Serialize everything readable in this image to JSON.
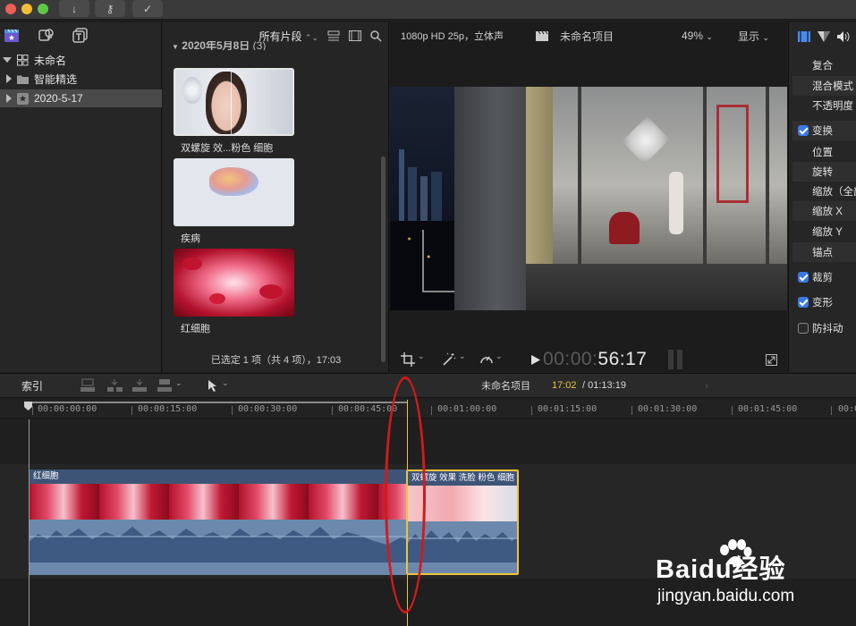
{
  "titlebar": {
    "buttons": [
      {
        "icon": "download-icon",
        "glyph": "↓"
      },
      {
        "icon": "key-icon",
        "glyph": "⚷"
      },
      {
        "icon": "checkmark-icon",
        "glyph": "✓"
      }
    ]
  },
  "sidebar": {
    "items": [
      {
        "label": "未命名",
        "icon": "library-icon"
      },
      {
        "label": "智能精选",
        "icon": "folder-icon"
      },
      {
        "label": "2020-5-17",
        "icon": "event-star-icon"
      }
    ]
  },
  "browser": {
    "filter_label": "所有片段",
    "section_date": "2020年5月8日",
    "section_count": "(3)",
    "clips": [
      {
        "label": "双螺旋 效...粉色 细胞"
      },
      {
        "label": "疾病"
      },
      {
        "label": "红细胞"
      }
    ],
    "status": "已选定 1 项（共 4 项），17:03"
  },
  "viewer": {
    "format": "1080p HD 25p，立体声",
    "project_name": "未命名项目",
    "zoom": "49%",
    "display_label": "显示",
    "timecode_dim": "00:00:",
    "timecode": "56:17"
  },
  "inspector": {
    "rows": [
      {
        "label": "复合",
        "type": "header"
      },
      {
        "label": "混合模式",
        "type": "sub"
      },
      {
        "label": "不透明度",
        "type": "sub"
      },
      {
        "label": "变换",
        "type": "check",
        "checked": true
      },
      {
        "label": "位置",
        "type": "sub"
      },
      {
        "label": "旋转",
        "type": "sub"
      },
      {
        "label": "缩放（全部）",
        "type": "sub"
      },
      {
        "label": "缩放 X",
        "type": "sub"
      },
      {
        "label": "缩放 Y",
        "type": "sub"
      },
      {
        "label": "锚点",
        "type": "sub"
      },
      {
        "label": "裁剪",
        "type": "check",
        "checked": true
      },
      {
        "label": "变形",
        "type": "check",
        "checked": true
      },
      {
        "label": "防抖动",
        "type": "check",
        "checked": false
      }
    ]
  },
  "timeline": {
    "index_label": "索引",
    "project_name": "未命名项目",
    "position": "17:02",
    "duration": "/ 01:13:19",
    "ruler_labels": [
      "00:00:00:00",
      "00:00:15:00",
      "00:00:30:00",
      "00:00:45:00",
      "00:01:00:00",
      "00:01:15:00",
      "00:01:30:00",
      "00:01:45:00",
      "00:0"
    ],
    "clips": [
      {
        "title": "红细胞"
      },
      {
        "title": "双螺旋 效果 洗脸 粉色 细胞"
      }
    ]
  },
  "watermark": {
    "brand": "Baidu经验",
    "url": "jingyan.baidu.com"
  },
  "colors": {
    "accent_blue": "#3b78e7",
    "playhead": "#e8c43a",
    "selection_yellow": "#f0c43a",
    "annotation_red": "#d21a1a",
    "audio_blue": "#6c88ad"
  }
}
